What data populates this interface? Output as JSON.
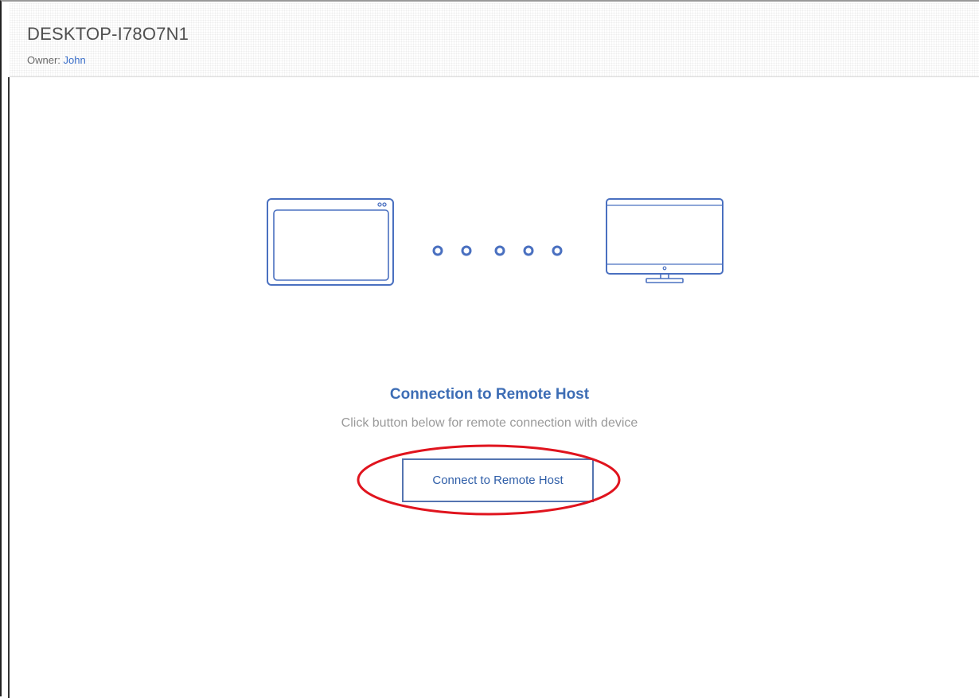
{
  "header": {
    "device_name": "DESKTOP-I78O7N1",
    "owner_label": "Owner:",
    "owner_name": "John"
  },
  "illustration": {
    "left_device_icon": "tablet-icon",
    "right_device_icon": "monitor-icon",
    "dot_count": 5
  },
  "connection": {
    "title": "Connection to Remote Host",
    "subtitle": "Click button below for remote connection with device",
    "button_label": "Connect to Remote Host"
  },
  "colors": {
    "accent": "#3d6db5",
    "icon_stroke": "#4a70c0",
    "annotation_red": "#e0141e",
    "subtitle_gray": "#9a9a9a"
  }
}
